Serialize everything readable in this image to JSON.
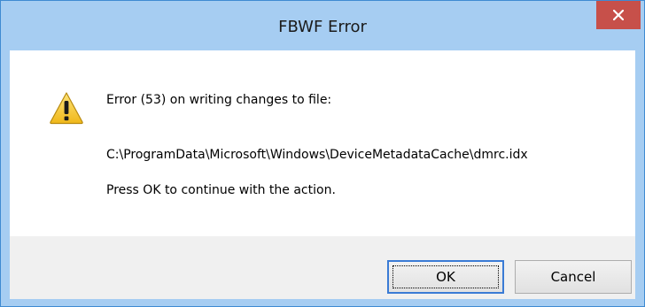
{
  "window": {
    "title": "FBWF Error",
    "close_icon": "close-icon",
    "titlebar_color": "#a6cdf2",
    "close_button_color": "#c7504a"
  },
  "message": {
    "icon": "warning-icon",
    "line1": "Error (53) on writing changes to file:",
    "path": "C:\\ProgramData\\Microsoft\\Windows\\DeviceMetadataCache\\dmrc.idx",
    "line3": "Press OK to continue with the action."
  },
  "buttons": {
    "ok_label": "OK",
    "cancel_label": "Cancel"
  }
}
